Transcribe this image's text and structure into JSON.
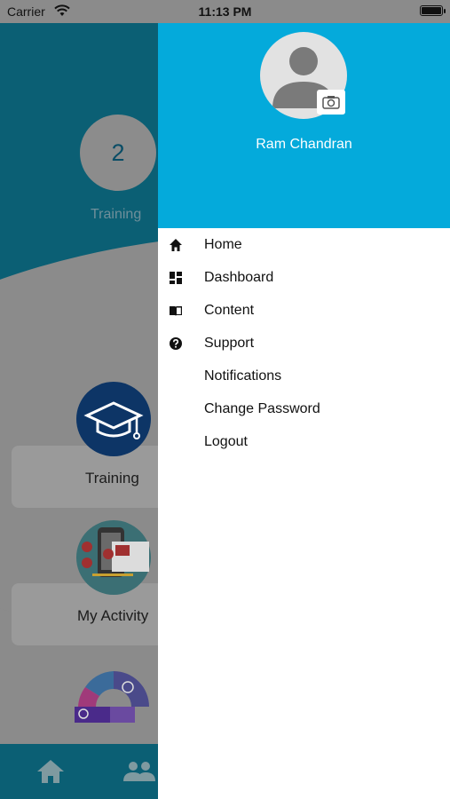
{
  "status_bar": {
    "carrier": "Carrier",
    "time": "11:13 PM"
  },
  "background_screen": {
    "count_value": "2",
    "count_label": "Training",
    "cards": [
      {
        "label": "Training"
      },
      {
        "label": "My Activity"
      }
    ]
  },
  "drawer": {
    "user_name": "Ram Chandran",
    "menu": [
      {
        "label": "Home",
        "icon": "home-icon"
      },
      {
        "label": "Dashboard",
        "icon": "dashboard-icon"
      },
      {
        "label": "Content",
        "icon": "book-icon"
      },
      {
        "label": "Support",
        "icon": "help-icon"
      },
      {
        "label": "Notifications",
        "icon": ""
      },
      {
        "label": "Change Password",
        "icon": ""
      },
      {
        "label": "Logout",
        "icon": ""
      }
    ]
  },
  "colors": {
    "drawer_header": "#04aadb",
    "app_header": "#0b5f74"
  }
}
